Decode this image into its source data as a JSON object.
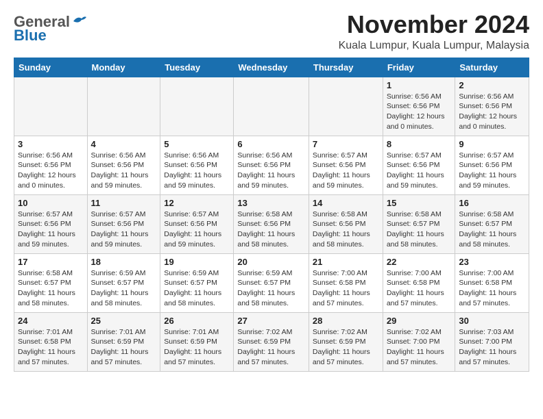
{
  "header": {
    "logo_line1": "General",
    "logo_line2": "Blue",
    "month_title": "November 2024",
    "location": "Kuala Lumpur, Kuala Lumpur, Malaysia"
  },
  "weekdays": [
    "Sunday",
    "Monday",
    "Tuesday",
    "Wednesday",
    "Thursday",
    "Friday",
    "Saturday"
  ],
  "weeks": [
    [
      {
        "day": "",
        "info": ""
      },
      {
        "day": "",
        "info": ""
      },
      {
        "day": "",
        "info": ""
      },
      {
        "day": "",
        "info": ""
      },
      {
        "day": "",
        "info": ""
      },
      {
        "day": "1",
        "info": "Sunrise: 6:56 AM\nSunset: 6:56 PM\nDaylight: 12 hours and 0 minutes."
      },
      {
        "day": "2",
        "info": "Sunrise: 6:56 AM\nSunset: 6:56 PM\nDaylight: 12 hours and 0 minutes."
      }
    ],
    [
      {
        "day": "3",
        "info": "Sunrise: 6:56 AM\nSunset: 6:56 PM\nDaylight: 12 hours and 0 minutes."
      },
      {
        "day": "4",
        "info": "Sunrise: 6:56 AM\nSunset: 6:56 PM\nDaylight: 11 hours and 59 minutes."
      },
      {
        "day": "5",
        "info": "Sunrise: 6:56 AM\nSunset: 6:56 PM\nDaylight: 11 hours and 59 minutes."
      },
      {
        "day": "6",
        "info": "Sunrise: 6:56 AM\nSunset: 6:56 PM\nDaylight: 11 hours and 59 minutes."
      },
      {
        "day": "7",
        "info": "Sunrise: 6:57 AM\nSunset: 6:56 PM\nDaylight: 11 hours and 59 minutes."
      },
      {
        "day": "8",
        "info": "Sunrise: 6:57 AM\nSunset: 6:56 PM\nDaylight: 11 hours and 59 minutes."
      },
      {
        "day": "9",
        "info": "Sunrise: 6:57 AM\nSunset: 6:56 PM\nDaylight: 11 hours and 59 minutes."
      }
    ],
    [
      {
        "day": "10",
        "info": "Sunrise: 6:57 AM\nSunset: 6:56 PM\nDaylight: 11 hours and 59 minutes."
      },
      {
        "day": "11",
        "info": "Sunrise: 6:57 AM\nSunset: 6:56 PM\nDaylight: 11 hours and 59 minutes."
      },
      {
        "day": "12",
        "info": "Sunrise: 6:57 AM\nSunset: 6:56 PM\nDaylight: 11 hours and 59 minutes."
      },
      {
        "day": "13",
        "info": "Sunrise: 6:58 AM\nSunset: 6:56 PM\nDaylight: 11 hours and 58 minutes."
      },
      {
        "day": "14",
        "info": "Sunrise: 6:58 AM\nSunset: 6:56 PM\nDaylight: 11 hours and 58 minutes."
      },
      {
        "day": "15",
        "info": "Sunrise: 6:58 AM\nSunset: 6:57 PM\nDaylight: 11 hours and 58 minutes."
      },
      {
        "day": "16",
        "info": "Sunrise: 6:58 AM\nSunset: 6:57 PM\nDaylight: 11 hours and 58 minutes."
      }
    ],
    [
      {
        "day": "17",
        "info": "Sunrise: 6:58 AM\nSunset: 6:57 PM\nDaylight: 11 hours and 58 minutes."
      },
      {
        "day": "18",
        "info": "Sunrise: 6:59 AM\nSunset: 6:57 PM\nDaylight: 11 hours and 58 minutes."
      },
      {
        "day": "19",
        "info": "Sunrise: 6:59 AM\nSunset: 6:57 PM\nDaylight: 11 hours and 58 minutes."
      },
      {
        "day": "20",
        "info": "Sunrise: 6:59 AM\nSunset: 6:57 PM\nDaylight: 11 hours and 58 minutes."
      },
      {
        "day": "21",
        "info": "Sunrise: 7:00 AM\nSunset: 6:58 PM\nDaylight: 11 hours and 57 minutes."
      },
      {
        "day": "22",
        "info": "Sunrise: 7:00 AM\nSunset: 6:58 PM\nDaylight: 11 hours and 57 minutes."
      },
      {
        "day": "23",
        "info": "Sunrise: 7:00 AM\nSunset: 6:58 PM\nDaylight: 11 hours and 57 minutes."
      }
    ],
    [
      {
        "day": "24",
        "info": "Sunrise: 7:01 AM\nSunset: 6:58 PM\nDaylight: 11 hours and 57 minutes."
      },
      {
        "day": "25",
        "info": "Sunrise: 7:01 AM\nSunset: 6:59 PM\nDaylight: 11 hours and 57 minutes."
      },
      {
        "day": "26",
        "info": "Sunrise: 7:01 AM\nSunset: 6:59 PM\nDaylight: 11 hours and 57 minutes."
      },
      {
        "day": "27",
        "info": "Sunrise: 7:02 AM\nSunset: 6:59 PM\nDaylight: 11 hours and 57 minutes."
      },
      {
        "day": "28",
        "info": "Sunrise: 7:02 AM\nSunset: 6:59 PM\nDaylight: 11 hours and 57 minutes."
      },
      {
        "day": "29",
        "info": "Sunrise: 7:02 AM\nSunset: 7:00 PM\nDaylight: 11 hours and 57 minutes."
      },
      {
        "day": "30",
        "info": "Sunrise: 7:03 AM\nSunset: 7:00 PM\nDaylight: 11 hours and 57 minutes."
      }
    ]
  ]
}
